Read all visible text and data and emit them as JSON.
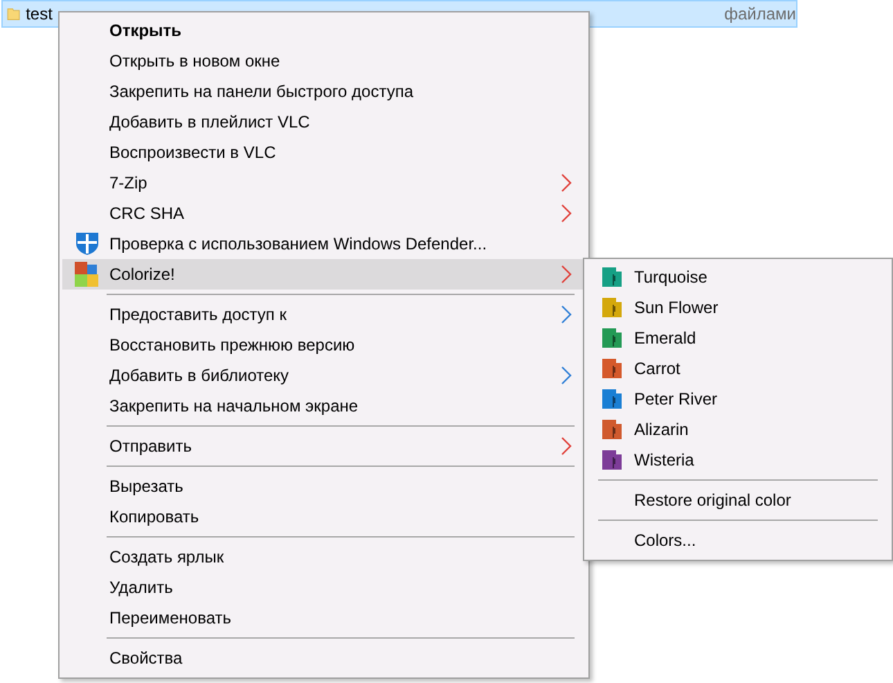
{
  "file_row": {
    "name": "test",
    "type": "файлами",
    "selected": true
  },
  "context_menu": {
    "groups": [
      [
        {
          "label": "Открыть",
          "default": true,
          "kind": "none",
          "submenu": false,
          "selected": false
        },
        {
          "label": "Открыть в новом окне",
          "default": false,
          "kind": "none",
          "submenu": false,
          "selected": false
        },
        {
          "label": "Закрепить на панели быстрого доступа",
          "default": false,
          "kind": "none",
          "submenu": false,
          "selected": false
        },
        {
          "label": "Добавить в плейлист VLC",
          "default": false,
          "kind": "none",
          "submenu": false,
          "selected": false
        },
        {
          "label": "Воспроизвести в VLC",
          "default": false,
          "kind": "none",
          "submenu": false,
          "selected": false
        },
        {
          "label": "7-Zip",
          "default": false,
          "kind": "none",
          "submenu": true,
          "color": "#e0403a",
          "selected": false
        },
        {
          "label": "CRC SHA",
          "default": false,
          "kind": "none",
          "submenu": true,
          "color": "#e0403a",
          "selected": false
        },
        {
          "label": "Проверка с использованием Windows Defender...",
          "default": false,
          "kind": "shield",
          "submenu": false,
          "selected": false
        },
        {
          "label": "Colorize!",
          "default": false,
          "kind": "palette",
          "submenu": true,
          "color": "#e0403a",
          "selected": true
        }
      ],
      [
        {
          "label": "Предоставить доступ к",
          "default": false,
          "kind": "none",
          "submenu": true,
          "color": "#2f7fd6",
          "selected": false
        },
        {
          "label": "Восстановить прежнюю версию",
          "default": false,
          "kind": "none",
          "submenu": false,
          "selected": false
        },
        {
          "label": "Добавить в библиотеку",
          "default": false,
          "kind": "none",
          "submenu": true,
          "color": "#2f7fd6",
          "selected": false
        },
        {
          "label": "Закрепить на начальном экране",
          "default": false,
          "kind": "none",
          "submenu": false,
          "selected": false
        }
      ],
      [
        {
          "label": "Отправить",
          "default": false,
          "kind": "none",
          "submenu": true,
          "color": "#e0403a",
          "selected": false
        }
      ],
      [
        {
          "label": "Вырезать",
          "default": false,
          "kind": "none",
          "submenu": false,
          "selected": false
        },
        {
          "label": "Копировать",
          "default": false,
          "kind": "none",
          "submenu": false,
          "selected": false
        }
      ],
      [
        {
          "label": "Создать ярлык",
          "default": false,
          "kind": "none",
          "submenu": false,
          "selected": false
        },
        {
          "label": "Удалить",
          "default": false,
          "kind": "none",
          "submenu": false,
          "selected": false
        },
        {
          "label": "Переименовать",
          "default": false,
          "kind": "none",
          "submenu": false,
          "selected": false
        }
      ],
      [
        {
          "label": "Свойства",
          "default": false,
          "kind": "none",
          "submenu": false,
          "selected": false
        }
      ]
    ]
  },
  "colorize_submenu": {
    "groups": [
      [
        {
          "label": "Turquoise",
          "kind": "folder",
          "color": "#16a085"
        },
        {
          "label": "Sun Flower",
          "kind": "folder",
          "color": "#d4a80c"
        },
        {
          "label": "Emerald",
          "kind": "folder",
          "color": "#239a55"
        },
        {
          "label": "Carrot",
          "kind": "folder",
          "color": "#d5592b"
        },
        {
          "label": "Peter River",
          "kind": "folder",
          "color": "#1a7fd4"
        },
        {
          "label": "Alizarin",
          "kind": "folder",
          "color": "#d05a2e"
        },
        {
          "label": "Wisteria",
          "kind": "folder",
          "color": "#7d3c98"
        }
      ],
      [
        {
          "label": "Restore original color",
          "kind": "none"
        }
      ],
      [
        {
          "label": "Colors...",
          "kind": "none"
        }
      ]
    ]
  }
}
